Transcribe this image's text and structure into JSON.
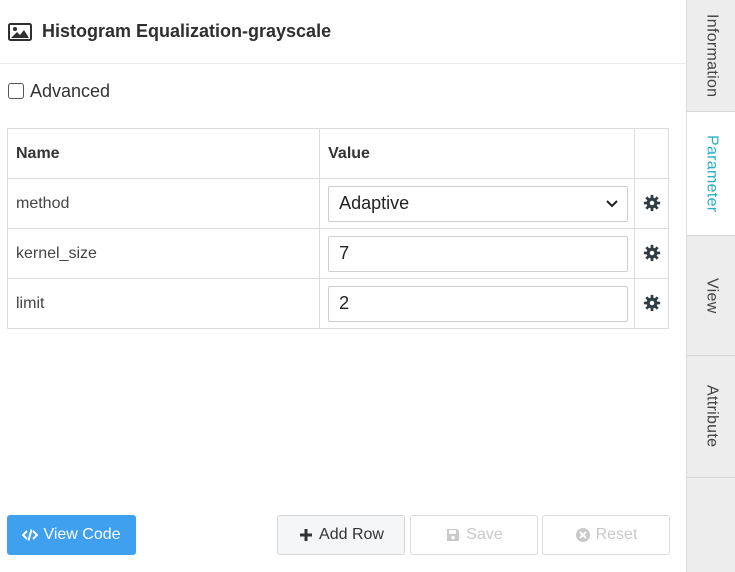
{
  "header": {
    "title": "Histogram Equalization-grayscale",
    "icon": "image-icon"
  },
  "advanced": {
    "label": "Advanced",
    "checked": false
  },
  "table": {
    "headers": {
      "name": "Name",
      "value": "Value"
    },
    "rows": [
      {
        "name": "method",
        "value": "Adaptive",
        "type": "select"
      },
      {
        "name": "kernel_size",
        "value": "7",
        "type": "input"
      },
      {
        "name": "limit",
        "value": "2",
        "type": "input"
      }
    ]
  },
  "buttons": {
    "view_code": "View Code",
    "add_row": "Add Row",
    "save": "Save",
    "reset": "Reset"
  },
  "sidebar": {
    "tabs": [
      "Information",
      "Parameter",
      "View",
      "Attribute"
    ],
    "active": "Parameter"
  },
  "colors": {
    "accent": "#26b0c4",
    "primary_button": "#3fa0f0"
  }
}
